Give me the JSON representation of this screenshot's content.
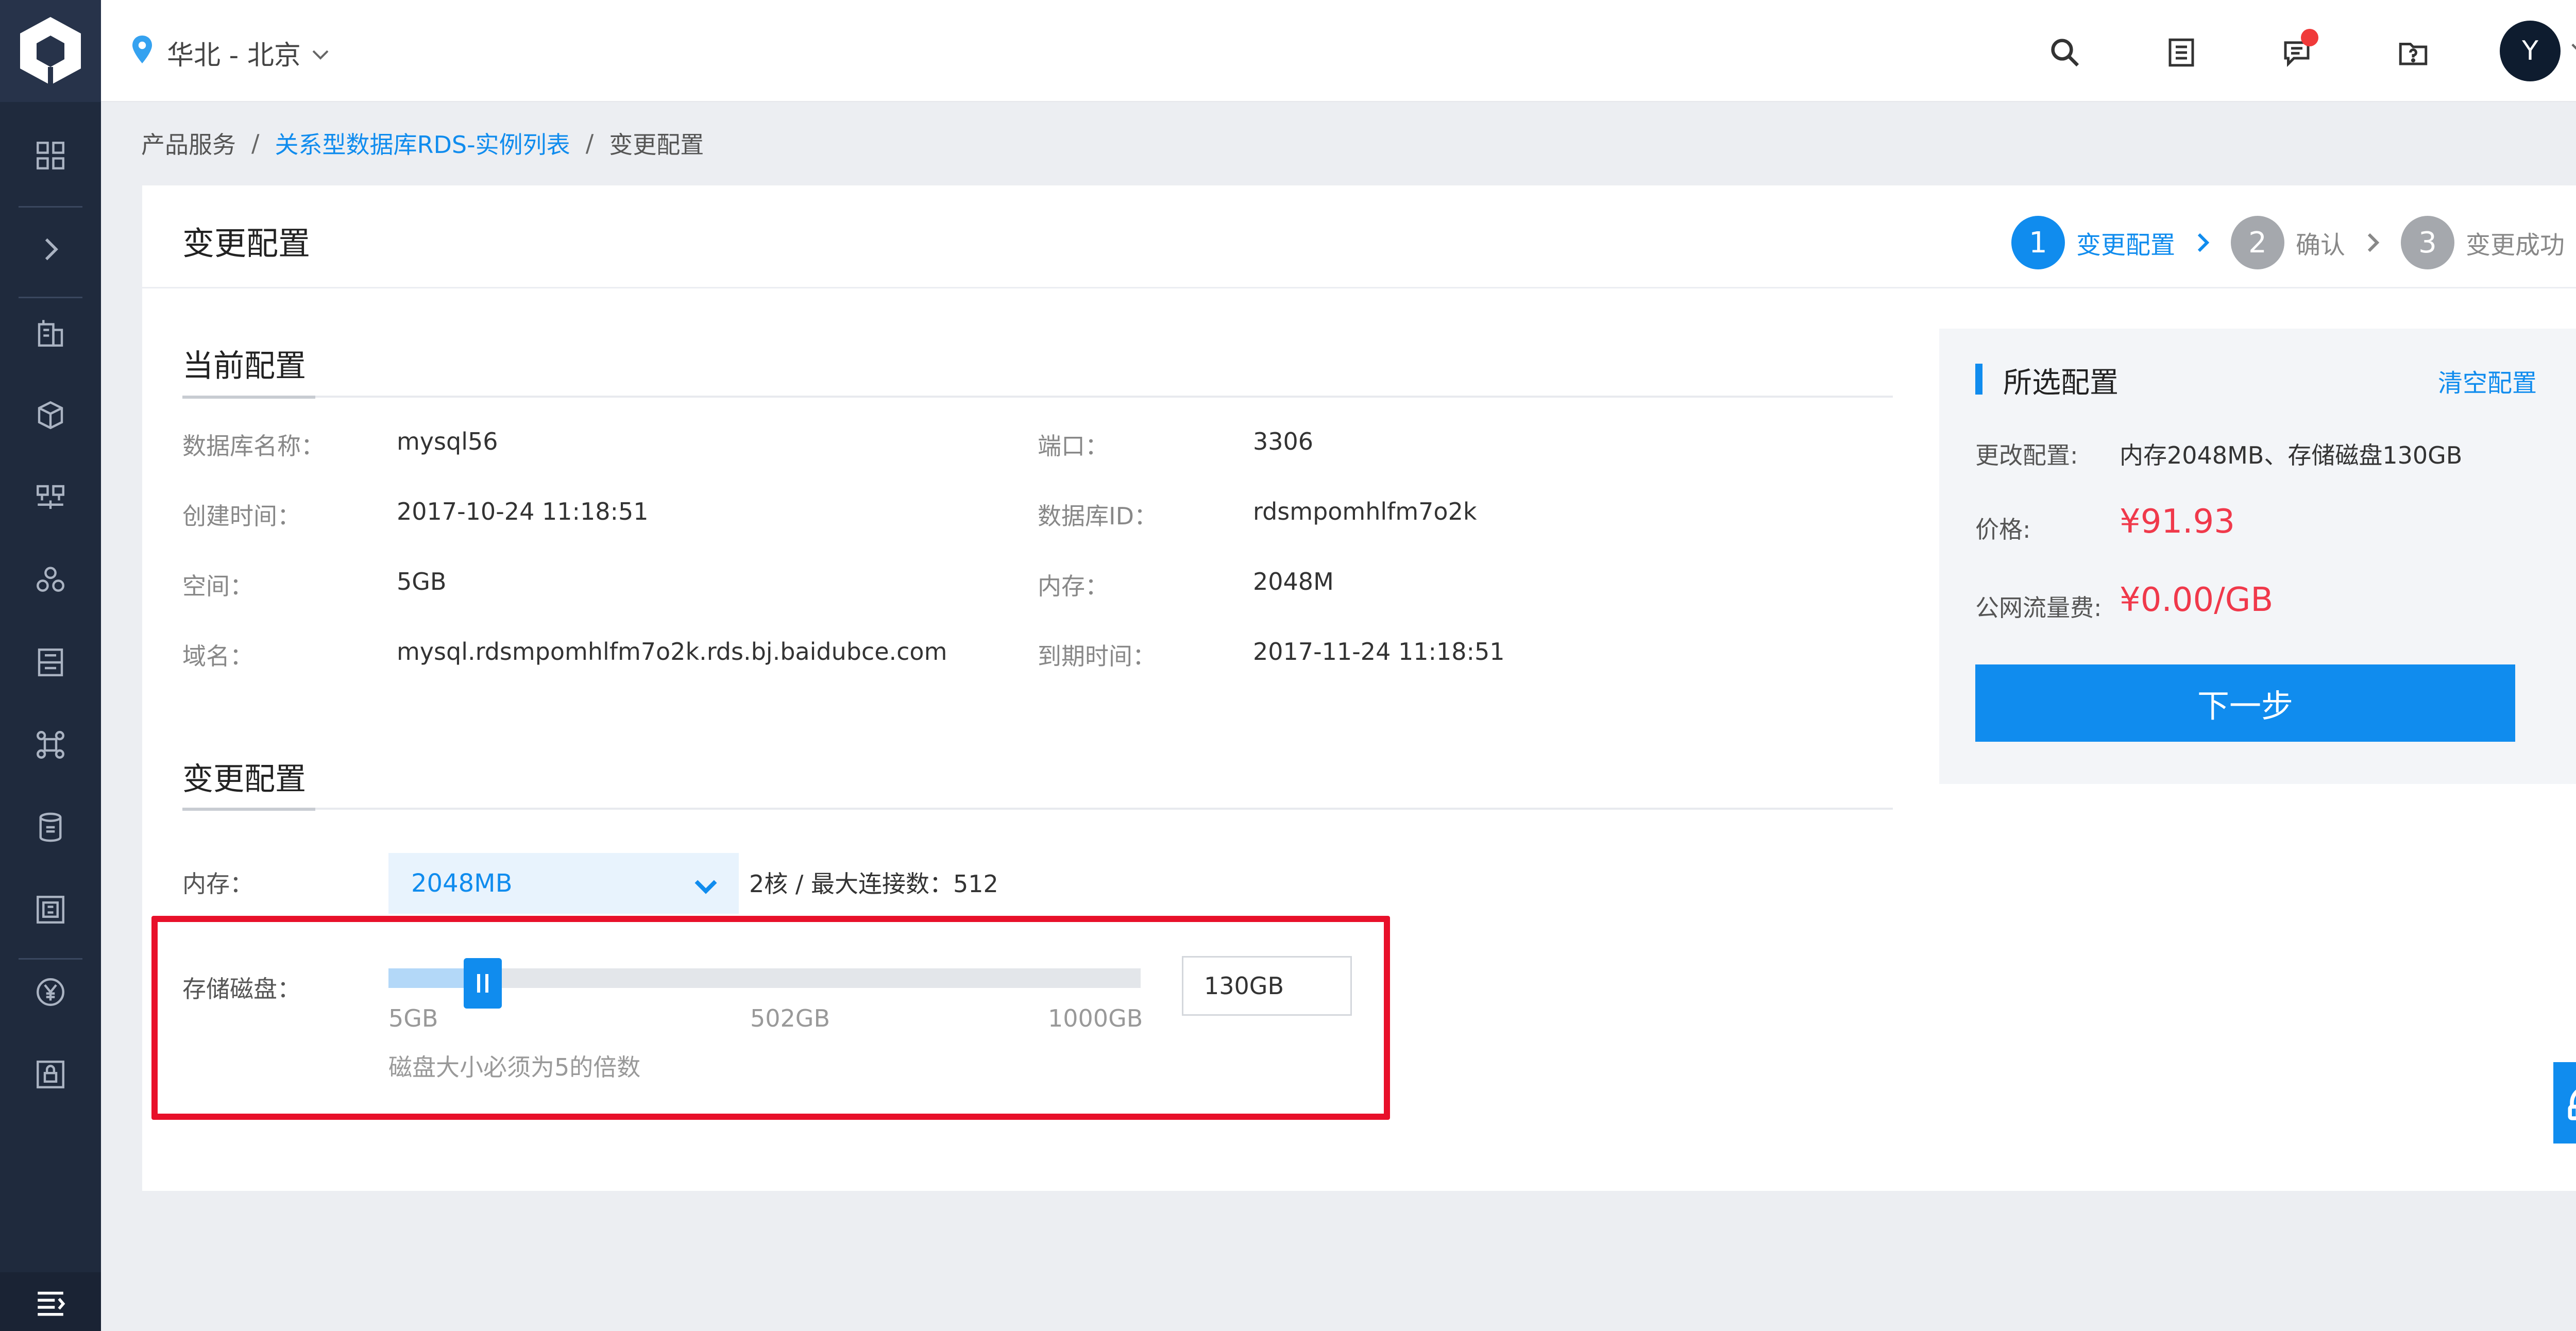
{
  "topbar": {
    "region": "华北 - 北京",
    "avatar_letter": "Y",
    "icons": [
      "search-icon",
      "list-icon",
      "message-icon",
      "help-folder-icon"
    ]
  },
  "sidebar": {
    "icons": [
      "dashboard-grid-icon",
      "expand-chevron-icon",
      "building-icon",
      "cube-icon",
      "network-icon",
      "cluster-icon",
      "storage-icon",
      "command-icon",
      "database-icon",
      "qr-icon",
      "billing-yen-icon",
      "security-lock-icon",
      "menu-collapse-icon"
    ]
  },
  "breadcrumb": {
    "root": "产品服务",
    "link": "关系型数据库RDS-实例列表",
    "current": "变更配置"
  },
  "page": {
    "title": "变更配置"
  },
  "steps": [
    {
      "num": "1",
      "label": "变更配置",
      "active": true
    },
    {
      "num": "2",
      "label": "确认",
      "active": false
    },
    {
      "num": "3",
      "label": "变更成功",
      "active": false
    }
  ],
  "current_config": {
    "title": "当前配置",
    "db_name_label": "数据库名称：",
    "db_name": "mysql56",
    "port_label": "端口：",
    "port": "3306",
    "created_label": "创建时间：",
    "created": "2017-10-24 11:18:51",
    "db_id_label": "数据库ID：",
    "db_id": "rdsmpomhlfm7o2k",
    "space_label": "空间：",
    "space": "5GB",
    "memory_label": "内存：",
    "memory": "2048M",
    "domain_label": "域名：",
    "domain": "mysql.rdsmpomhlfm7o2k.rds.bj.baidubce.com",
    "expire_label": "到期时间：",
    "expire": "2017-11-24 11:18:51"
  },
  "change_config": {
    "title": "变更配置",
    "memory_label": "内存：",
    "memory_selected": "2048MB",
    "memory_info": "2核 / 最大连接数：512",
    "storage_label": "存储磁盘：",
    "slider_min": "5GB",
    "slider_mid": "502GB",
    "slider_max": "1000GB",
    "slider_value_fraction": 0.125,
    "storage_value": "130GB",
    "storage_hint": "磁盘大小必须为5的倍数"
  },
  "summary": {
    "title": "所选配置",
    "clear": "清空配置",
    "change_label": "更改配置:",
    "change_value": "内存2048MB、存储磁盘130GB",
    "price_label": "价格:",
    "price": "¥91.93",
    "traffic_label": "公网流量费:",
    "traffic": "¥0.00/GB",
    "next_button": "下一步"
  },
  "colors": {
    "accent": "#108cee",
    "sidebar": "#1f2a3d",
    "price": "#f0394b",
    "highlight": "#e8102a"
  }
}
